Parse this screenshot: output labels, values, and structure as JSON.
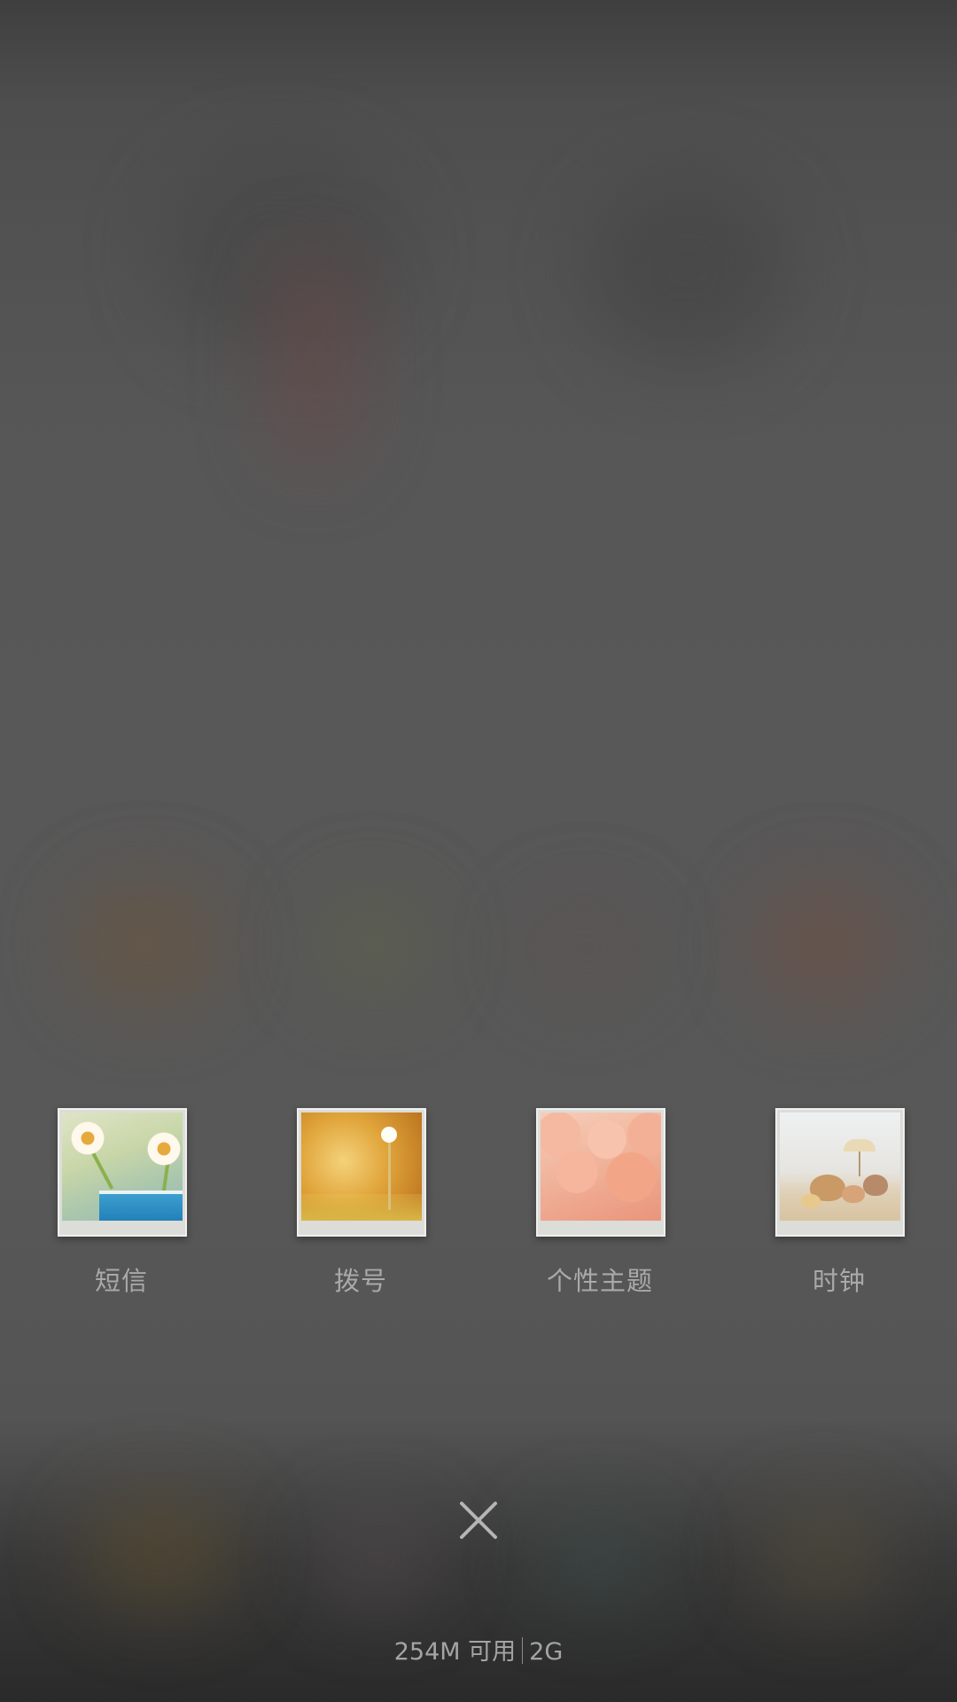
{
  "recent_apps": [
    {
      "label": "短信",
      "thumbnail_icon": "daisies-photo"
    },
    {
      "label": "拨号",
      "thumbnail_icon": "dandelion-photo"
    },
    {
      "label": "个性主题",
      "thumbnail_icon": "peonies-photo"
    },
    {
      "label": "时钟",
      "thumbnail_icon": "seashells-photo"
    }
  ],
  "close_button": {
    "icon": "close-icon"
  },
  "memory": {
    "available": "254M 可用",
    "total": "2G"
  },
  "colors": {
    "overlay": "#575757",
    "label_text": "#a9a9a9",
    "close_icon": "#b5b5b5"
  }
}
